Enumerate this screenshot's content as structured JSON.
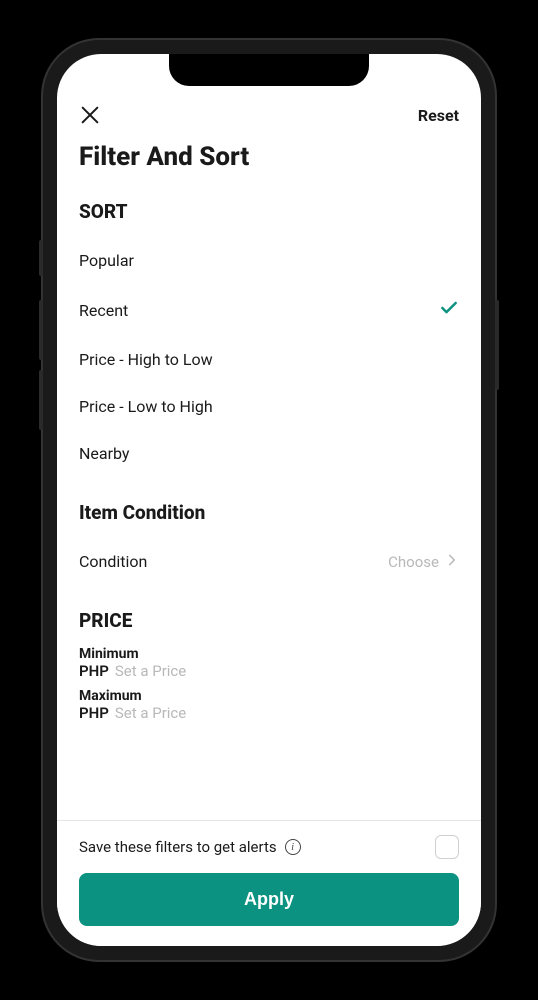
{
  "header": {
    "reset_label": "Reset"
  },
  "page_title": "Filter And Sort",
  "sort": {
    "heading": "SORT",
    "items": [
      {
        "label": "Popular",
        "selected": false
      },
      {
        "label": "Recent",
        "selected": true
      },
      {
        "label": "Price - High to Low",
        "selected": false
      },
      {
        "label": "Price - Low to High",
        "selected": false
      },
      {
        "label": "Nearby",
        "selected": false
      }
    ]
  },
  "condition": {
    "heading": "Item Condition",
    "row_label": "Condition",
    "choose_label": "Choose"
  },
  "price": {
    "heading": "PRICE",
    "min_label": "Minimum",
    "max_label": "Maximum",
    "currency": "PHP",
    "placeholder": "Set a Price"
  },
  "footer": {
    "save_label": "Save these filters to get alerts",
    "apply_label": "Apply"
  },
  "colors": {
    "accent": "#0b9280"
  }
}
